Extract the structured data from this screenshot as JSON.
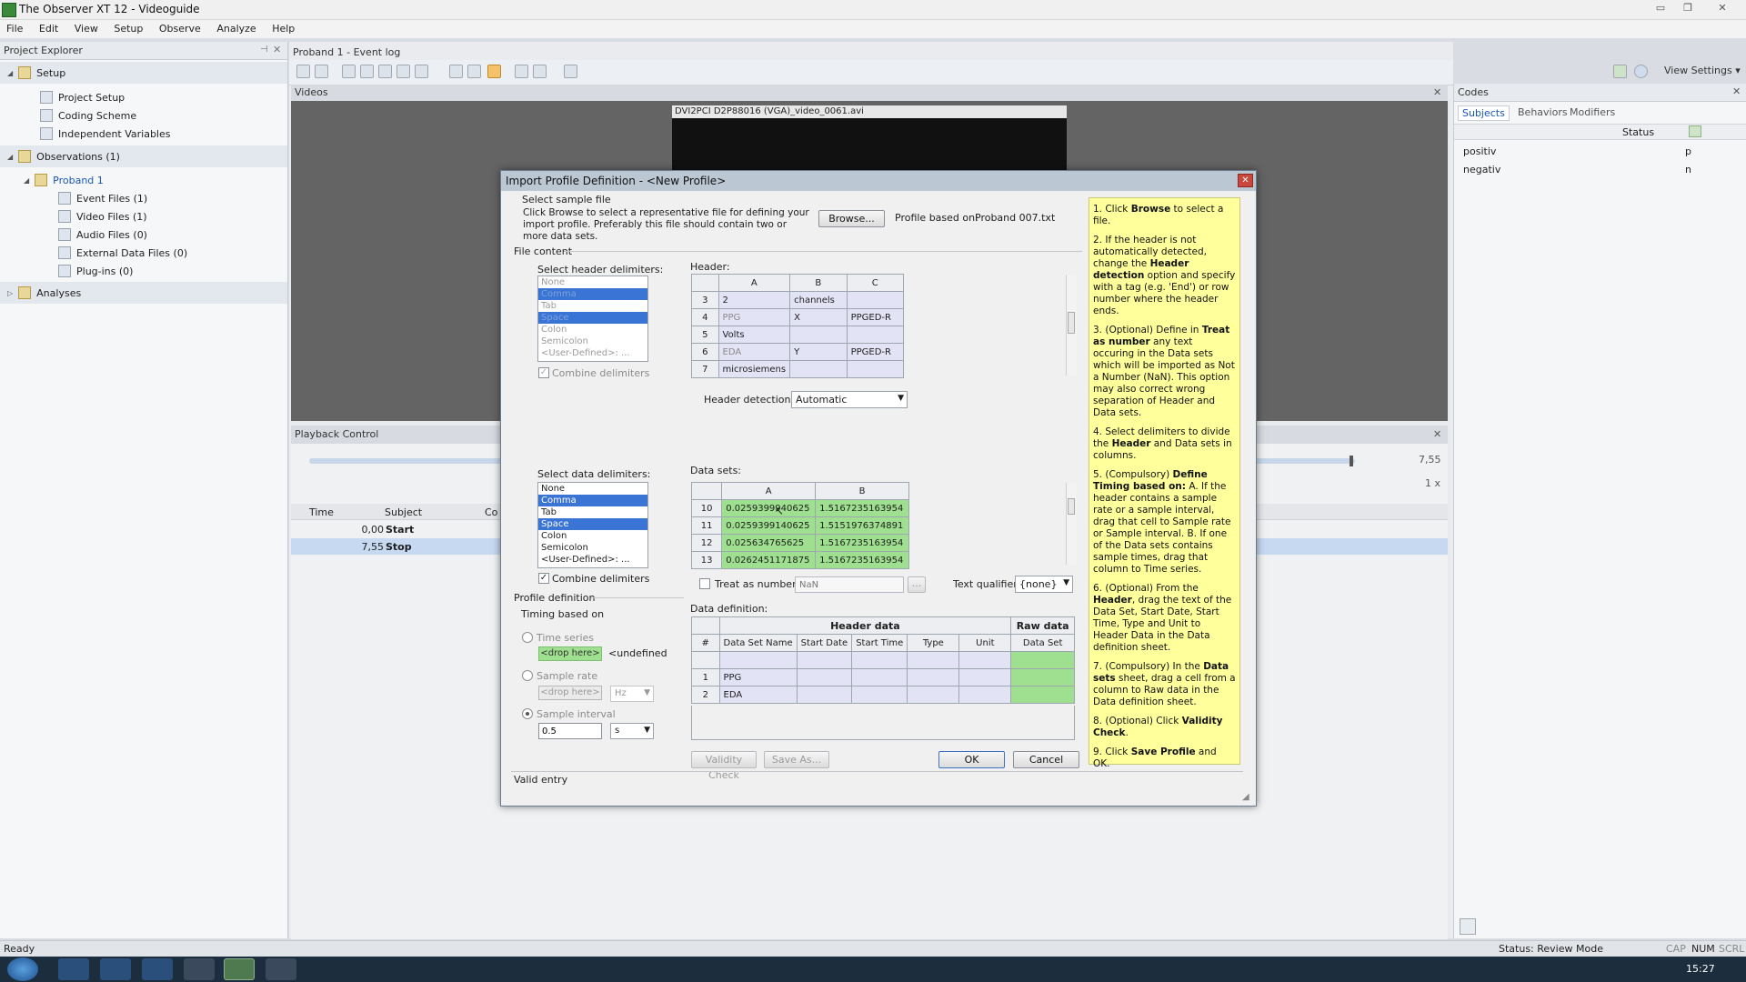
{
  "window": {
    "title": "The Observer XT 12 - Videoguide"
  },
  "menu": [
    "File",
    "Edit",
    "View",
    "Setup",
    "Observe",
    "Analyze",
    "Help"
  ],
  "project_explorer": {
    "title": "Project Explorer",
    "setup": "Setup",
    "setup_items": [
      "Project Setup",
      "Coding Scheme",
      "Independent Variables"
    ],
    "observations": "Observations (1)",
    "proband": "Proband 1",
    "proband_items": [
      "Event Files (1)",
      "Video Files (1)",
      "Audio Files (0)",
      "External Data Files (0)",
      "Plug-ins (0)"
    ],
    "analyses": "Analyses"
  },
  "doc_tab": "Proband 1 - Event log",
  "view_settings": "View Settings",
  "videos": {
    "title": "Videos",
    "file": "DVI2PCI D2P88016 (VGA)_video_0061.avi"
  },
  "playback": {
    "title": "Playback Control",
    "time_right": "7,55",
    "speed": "1 x",
    "columns": [
      "Time",
      "Subject",
      "Co"
    ],
    "rows": [
      {
        "time": "0,00",
        "subject": "Start"
      },
      {
        "time": "7,55",
        "subject": "Stop"
      }
    ]
  },
  "codes": {
    "title": "Codes",
    "tabs": [
      "Subjects",
      "Behaviors",
      "Modifiers"
    ],
    "status_header": "Status",
    "items": [
      {
        "name": "positiv",
        "key": "p"
      },
      {
        "name": "negativ",
        "key": "n"
      }
    ]
  },
  "statusbar": {
    "left": "Ready",
    "mode": "Status: Review Mode",
    "caps": "CAP",
    "num": "NUM",
    "scrl": "SCRL"
  },
  "taskbar": {
    "clock": "15:27"
  },
  "dialog": {
    "title": "Import Profile Definition - <New Profile>",
    "select_sample_file": "Select sample file",
    "instructions": "Click Browse to select a representative file for defining your import profile. Preferably this file should contain two or more data sets.",
    "browse": "Browse...",
    "profile_based_on_label": "Profile based on:",
    "profile_based_on_value": "Proband 007.txt",
    "file_content": "File content",
    "header_delims_label": "Select header delimiters:",
    "header_delims": [
      "None",
      "Comma",
      "Tab",
      "Space",
      "Colon",
      "Semicolon",
      "<User-Defined>: ..."
    ],
    "combine_delims": "Combine delimiters",
    "header_label": "Header:",
    "header_cols": [
      "A",
      "B",
      "C"
    ],
    "header_rows": [
      {
        "n": "3",
        "a": "2",
        "b": "channels",
        "c": ""
      },
      {
        "n": "4",
        "a": "PPG",
        "b": "X",
        "c": "PPGED-R"
      },
      {
        "n": "5",
        "a": "Volts",
        "b": "",
        "c": ""
      },
      {
        "n": "6",
        "a": "EDA",
        "b": "Y",
        "c": "PPGED-R"
      },
      {
        "n": "7",
        "a": "microsiemens",
        "b": "",
        "c": ""
      }
    ],
    "header_detection_label": "Header detection:",
    "header_detection_value": "Automatic",
    "data_delims_label": "Select data delimiters:",
    "data_delims": [
      "None",
      "Comma",
      "Tab",
      "Space",
      "Colon",
      "Semicolon",
      "<User-Defined>: ..."
    ],
    "data_sets_label": "Data sets:",
    "data_cols": [
      "A",
      "B"
    ],
    "data_rows": [
      {
        "n": "10",
        "a": "0.0259399940625",
        "b": "1.5167235163954"
      },
      {
        "n": "11",
        "a": "0.0259399140625",
        "b": "1.5151976374891"
      },
      {
        "n": "12",
        "a": "0.025634765625",
        "b": "1.5167235163954"
      },
      {
        "n": "13",
        "a": "0.0262451171875",
        "b": "1.5167235163954"
      }
    ],
    "treat_as_number": "Treat as number:",
    "nan_placeholder": "NaN",
    "ellipsis": "...",
    "text_qualifier_label": "Text qualifier:",
    "text_qualifier_value": "{none}",
    "profile_definition": "Profile definition",
    "timing_based_on": "Timing based on",
    "time_series": "Time series",
    "drop_here": "<drop here>",
    "undefined": "<undefined",
    "sample_rate": "Sample rate",
    "hz": "Hz",
    "sample_interval": "Sample interval",
    "interval_value": "0.5",
    "interval_unit": "s",
    "data_definition_label": "Data definition:",
    "dd_group_header": "Header data",
    "dd_group_raw": "Raw data",
    "dd_cols": [
      "#",
      "Data Set Name",
      "Start Date",
      "Start Time",
      "Type",
      "Unit",
      "Data Set"
    ],
    "dd_rows": [
      {
        "n": "1",
        "name": "PPG"
      },
      {
        "n": "2",
        "name": "EDA"
      }
    ],
    "validity_check": "Validity Check",
    "save_as": "Save As...",
    "ok": "OK",
    "cancel": "Cancel",
    "status": "Valid entry",
    "help": [
      {
        "pre": "1. Click ",
        "b": "Browse",
        "post": " to select a file."
      },
      {
        "pre": "2. If the header is not automatically detected, change the ",
        "b": "Header detection",
        "post": " option and specify with a tag (e.g. 'End') or row number where the header ends."
      },
      {
        "pre": "3. (Optional) Define in ",
        "b": "Treat as number",
        "post": " any text occuring in the Data sets which will be imported as Not a Number (NaN). This option may also correct wrong separation of Header and Data sets."
      },
      {
        "pre": "4. Select delimiters to divide the ",
        "b": "Header",
        "post": " and Data sets in columns."
      },
      {
        "pre": "5. (Compulsory) ",
        "b": "Define Timing based on:",
        "post": " A. If the header contains a sample rate or a sample interval, drag that cell to Sample rate or Sample interval. B. If one of the Data sets contains sample times, drag that column to Time series."
      },
      {
        "pre": "6. (Optional) From the ",
        "b": "Header",
        "post": ", drag the text of the Data Set, Start Date, Start Time, Type and Unit to Header Data in the Data definition sheet."
      },
      {
        "pre": "7. (Compulsory) In the ",
        "b": "Data sets",
        "post": " sheet, drag a cell from a column to Raw data in the Data definition sheet."
      },
      {
        "pre": "8. (Optional) Click ",
        "b": "Validity Check",
        "post": "."
      },
      {
        "pre": "9. Click ",
        "b": "Save Profile",
        "post": " and OK."
      }
    ]
  }
}
